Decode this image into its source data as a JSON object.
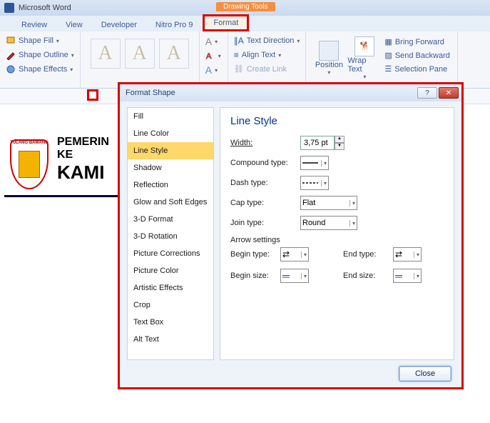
{
  "app": {
    "title": "Microsoft Word"
  },
  "tabs": {
    "review": "Review",
    "view": "View",
    "developer": "Developer",
    "nitro": "Nitro Pro 9",
    "drawing_tools": "Drawing Tools",
    "format": "Format"
  },
  "ribbon": {
    "shape_fill": "Shape Fill",
    "shape_outline": "Shape Outline",
    "shape_effects": "Shape Effects",
    "text_direction": "Text Direction",
    "align_text": "Align Text",
    "create_link": "Create Link",
    "position": "Position",
    "wrap_text": "Wrap Text",
    "bring_forward": "Bring Forward",
    "send_backward": "Send Backward",
    "selection_pane": "Selection Pane",
    "wa_letter": "A",
    "small_a_big": "A",
    "small_a_small": "A"
  },
  "doc": {
    "line1": "PEMERIN",
    "line2": "KE",
    "line3": "KAMI",
    "seal_top": "TULANG BAWANG"
  },
  "dialog": {
    "title": "Format Shape",
    "help": "?",
    "close_x": "✕",
    "cats": {
      "fill": "Fill",
      "line_color": "Line Color",
      "line_style": "Line Style",
      "shadow": "Shadow",
      "reflection": "Reflection",
      "glow": "Glow and Soft Edges",
      "fmt3d": "3-D Format",
      "rot3d": "3-D Rotation",
      "piccorr": "Picture Corrections",
      "piccolor": "Picture Color",
      "artistic": "Artistic Effects",
      "crop": "Crop",
      "textbox": "Text Box",
      "alttext": "Alt Text"
    },
    "heading": "Line Style",
    "labels": {
      "width": "Width:",
      "compound": "Compound type:",
      "dash": "Dash type:",
      "cap": "Cap type:",
      "join": "Join type:",
      "arrow_settings": "Arrow settings",
      "begin_type": "Begin type:",
      "end_type": "End type:",
      "begin_size": "Begin size:",
      "end_size": "End size:"
    },
    "values": {
      "width": "3,75 pt",
      "cap": "Flat",
      "join": "Round"
    },
    "close_btn": "Close"
  }
}
